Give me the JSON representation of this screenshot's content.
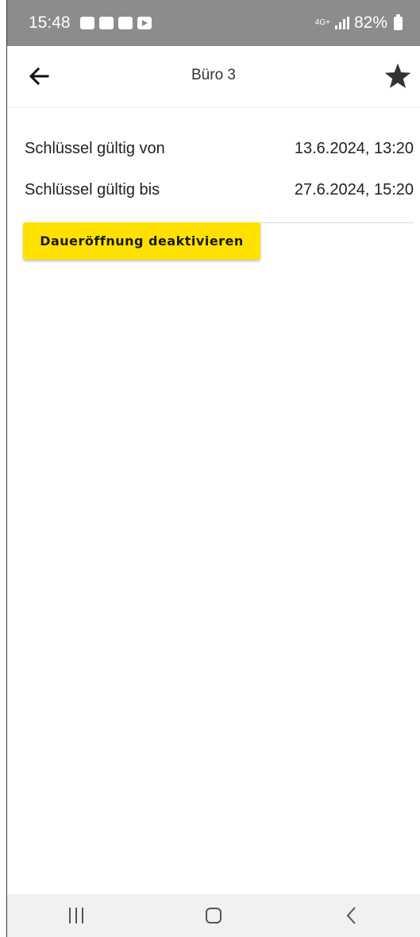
{
  "status_bar": {
    "time": "15:48",
    "network": "4G+",
    "battery": "82%",
    "notification_icons": [
      "teams-icon",
      "outlook-icon",
      "gallery-icon",
      "youtube-icon"
    ]
  },
  "header": {
    "title": "Büro 3",
    "back_icon": "arrow-left-icon",
    "favorite_icon": "star-icon"
  },
  "details": {
    "valid_from": {
      "label": "Schlüssel gültig von",
      "value": "13.6.2024, 13:20"
    },
    "valid_until": {
      "label": "Schlüssel gültig bis",
      "value": "27.6.2024, 15:20"
    }
  },
  "action": {
    "label": "Daueröffnung deaktivieren"
  },
  "nav_bar": {
    "icons": [
      "recent-apps-icon",
      "home-icon",
      "back-icon"
    ]
  },
  "colors": {
    "accent": "#ffe100",
    "status_bar": "#8c8c8c",
    "text": "#222222",
    "icon": "#333333"
  }
}
